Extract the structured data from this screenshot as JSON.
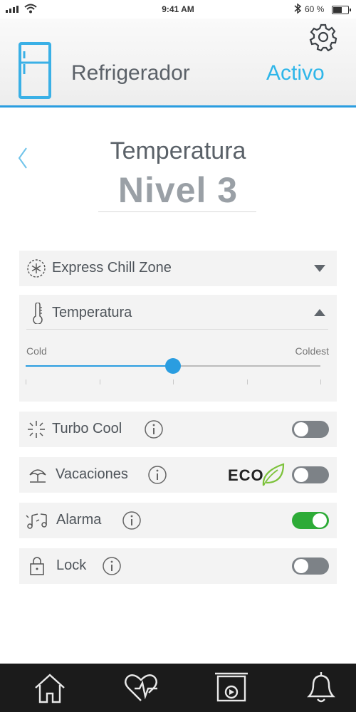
{
  "status_bar": {
    "time": "9:41 AM",
    "battery": "60 %",
    "battery_level": 0.6
  },
  "header": {
    "device_name": "Refrigerador",
    "status": "Activo"
  },
  "title": {
    "heading": "Temperatura",
    "level": "Nivel 3"
  },
  "sections": {
    "express_chill": {
      "label": "Express Chill Zone",
      "expanded": false
    },
    "temperature": {
      "label": "Temperatura",
      "expanded": true,
      "slider": {
        "min_label": "Cold",
        "max_label": "Coldest",
        "value": 0.5,
        "ticks": 5
      }
    }
  },
  "settings": {
    "turbo_cool": {
      "label": "Turbo Cool",
      "on": false
    },
    "vacaciones": {
      "label": "Vacaciones",
      "eco_label": "ECO",
      "on": false
    },
    "alarma": {
      "label": "Alarma",
      "on": true
    },
    "lock": {
      "label": "Lock",
      "on": false
    }
  },
  "colors": {
    "accent": "#2a9de0",
    "status": "#2fb6e9",
    "toggle_on": "#2dab37",
    "toggle_off": "#7d8287",
    "eco_leaf": "#7cc23a"
  },
  "nav": {
    "items": [
      "home-icon",
      "health-icon",
      "media-icon",
      "bell-icon"
    ]
  }
}
